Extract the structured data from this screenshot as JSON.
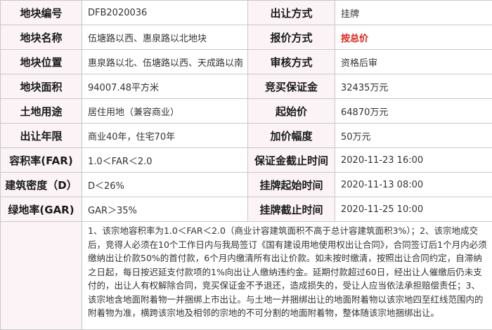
{
  "rows": [
    {
      "l1": "地块编号",
      "v1": "DFB2020036",
      "l2": "出让方式",
      "v2": "挂牌"
    },
    {
      "l1": "地块名称",
      "v1": "伍塘路以西、惠泉路以北地块",
      "l2": "报价方式",
      "v2": "按总价"
    },
    {
      "l1": "地块位置",
      "v1": "惠泉路以北、伍塘路以西、天成路以南",
      "l2": "审核方式",
      "v2": "资格后审"
    },
    {
      "l1": "地块面积",
      "v1": "94007.48平方米",
      "l2": "竞买保证金",
      "v2": "32435万元"
    },
    {
      "l1": "土地用途",
      "v1": "居住用地（兼容商业）",
      "l2": "起始价",
      "v2": "64870万元"
    },
    {
      "l1": "出让年限",
      "v1": "商业40年，住宅70年",
      "l2": "加价幅度",
      "v2": "50万元"
    },
    {
      "l1": "容积率(FAR)",
      "v1": "1.0＜FAR＜2.0",
      "l2": "保证金截止时间",
      "v2": "2020-11-23 16:00"
    },
    {
      "l1": "建筑密度（D）",
      "v1": "D＜26%",
      "l2": "挂牌起始时间",
      "v2": "2020-11-13 08:00"
    },
    {
      "l1": "绿地率(GAR)",
      "v1": "GAR＞35%",
      "l2": "挂牌截止时间",
      "v2": "2020-11-25 10:00"
    }
  ],
  "remarks": "1、该宗地容积率为1.0＜FAR＜2.0（商业计容建筑面积不高于总计容建筑面积3%）；2、该宗地成交后，竞得人必须在10个工作日内与我局签订《国有建设用地使用权出让合同》，合同签订后1个月内必须缴纳出让价款50%的首付款，6个月内缴清所有出让价款。如未按时缴清，按照出让合同约定，自滞纳之日起，每日按迟延支付款项的1%向出让人缴纳违约金。延期付款超过60日，经出让人催缴后仍未支付的，出让人有权解除合同，竞买保证金不予退还，造成损失的，受让人应当依法承担赔偿责任；3、该宗地含地面附着物一并捆绑上市出让。与土地一并捆绑出让的地面附着物以该宗地四至红线范围内的附着物为准，横跨该宗地及相邻的宗地的不可分割的地面附着物，整体随该宗地捆绑出让。"
}
